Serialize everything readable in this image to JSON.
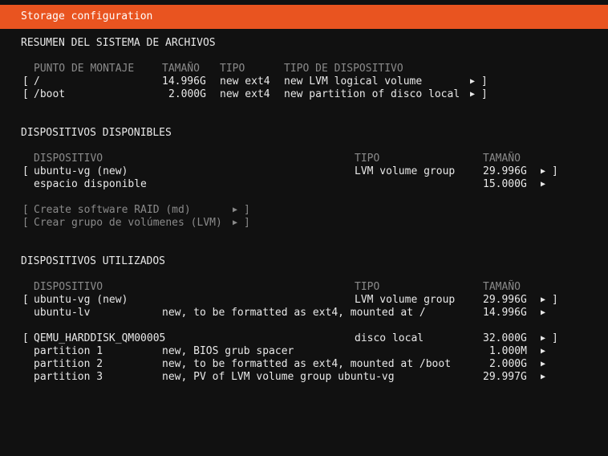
{
  "header": {
    "title": "Storage configuration"
  },
  "filesystem_summary": {
    "heading": "RESUMEN DEL SISTEMA DE ARCHIVOS",
    "columns": [
      "PUNTO DE MONTAJE",
      "TAMAÑO",
      "TIPO",
      "TIPO DE DISPOSITIVO"
    ],
    "rows": [
      {
        "mount": "/",
        "size": "14.996G",
        "type": "new ext4",
        "device_type": "new LVM logical volume"
      },
      {
        "mount": "/boot",
        "size": "2.000G",
        "type": "new ext4",
        "device_type": "new partition of disco local"
      }
    ]
  },
  "available_devices": {
    "heading": "DISPOSITIVOS DISPONIBLES",
    "columns": [
      "DISPOSITIVO",
      "TIPO",
      "TAMAÑO"
    ],
    "rows": [
      {
        "device": "ubuntu-vg (new)",
        "type": "LVM volume group",
        "size": "29.996G"
      },
      {
        "device": "espacio disponible",
        "type": "",
        "size": "15.000G"
      }
    ],
    "actions": [
      "Create software RAID (md)",
      "Crear grupo de volúmenes (LVM)"
    ]
  },
  "used_devices": {
    "heading": "DISPOSITIVOS UTILIZADOS",
    "columns": [
      "DISPOSITIVO",
      "TIPO",
      "TAMAÑO"
    ],
    "group1": [
      {
        "device": "ubuntu-vg (new)",
        "type": "LVM volume group",
        "size": "29.996G"
      },
      {
        "device": "ubuntu-lv",
        "type": "new, to be formatted as ext4, mounted at /",
        "size": "14.996G"
      }
    ],
    "group2": [
      {
        "device": "QEMU_HARDDISK_QM00005",
        "type": "disco local",
        "size": "32.000G"
      },
      {
        "device": "partition 1",
        "type": "new, BIOS grub spacer",
        "size": "1.000M"
      },
      {
        "device": "partition 2",
        "type": "new, to be formatted as ext4, mounted at /boot",
        "size": "2.000G"
      },
      {
        "device": "partition 3",
        "type": "new, PV of LVM volume group ubuntu-vg",
        "size": "29.997G"
      }
    ]
  },
  "glyphs": {
    "open_bracket": "[",
    "close_bracket": "]",
    "arrow": "▶"
  },
  "colors": {
    "header_bg": "#e95420",
    "background": "#111111",
    "text": "#e8e8e8",
    "disabled_text": "#8a8a8a"
  }
}
